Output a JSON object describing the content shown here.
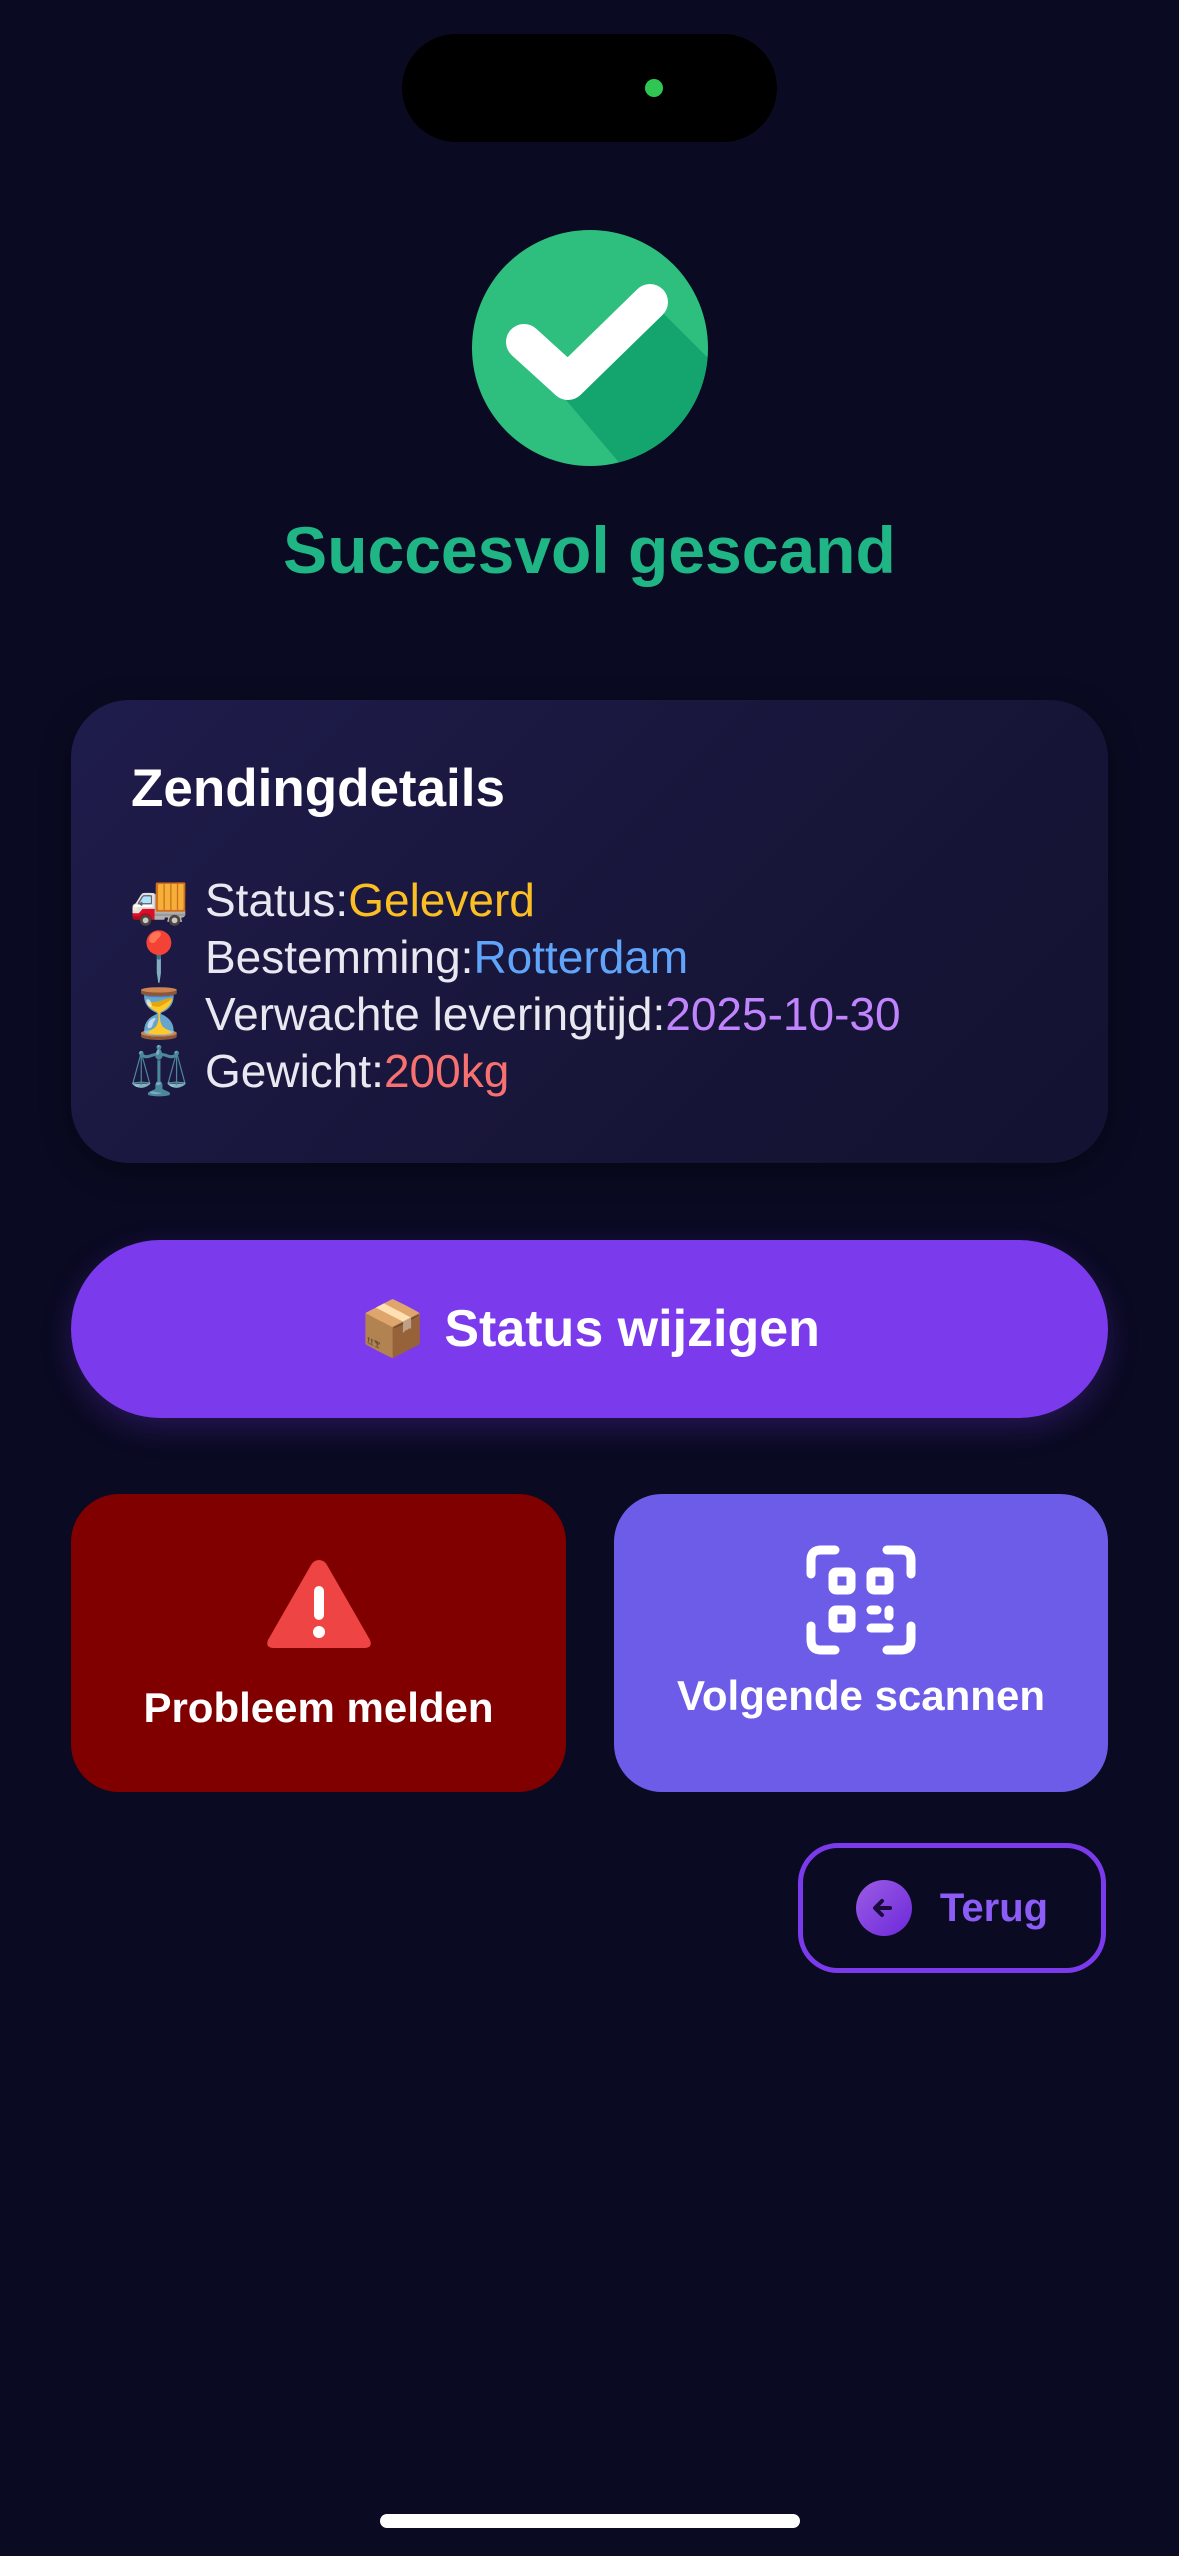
{
  "header": {
    "title": "Succesvol gescand"
  },
  "details": {
    "title": "Zendingdetails",
    "rows": [
      {
        "emoji": "🚚",
        "label": "Status: ",
        "value": "Geleverd"
      },
      {
        "emoji": "📍",
        "label": "Bestemming: ",
        "value": "Rotterdam"
      },
      {
        "emoji": "⏳",
        "label": "Verwachte leveringtijd: ",
        "value": "2025-10-30"
      },
      {
        "emoji": "⚖️",
        "label": "Gewicht: ",
        "value": "200kg"
      }
    ]
  },
  "actions": {
    "change_status_emoji": "📦",
    "change_status_label": "Status wijzigen",
    "report_problem_label": "Probleem melden",
    "scan_next_label": "Volgende scannen",
    "back_label": "Terug"
  },
  "icons": {
    "success": "check-circle-icon",
    "warning": "warning-triangle-icon",
    "scan": "qr-scan-icon",
    "back": "arrow-left-circle-icon"
  },
  "colors": {
    "background": "#0a0a22",
    "success": "#1fb585",
    "primary": "#7c3aed",
    "danger": "#800000",
    "secondary": "#6c5ce7",
    "status_value": "#fbbf24",
    "destination_value": "#60a5fa",
    "time_value": "#c084fc",
    "weight_value": "#f87171"
  }
}
